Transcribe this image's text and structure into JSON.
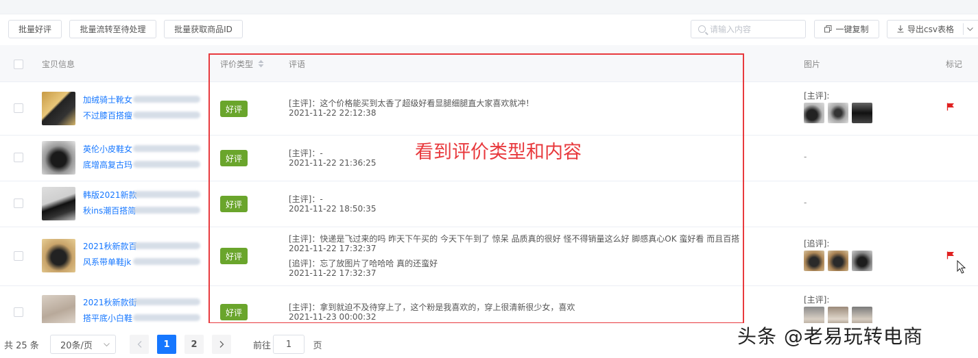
{
  "toolbar": {
    "batch_good": "批量好评",
    "batch_transfer": "批量流转至待处理",
    "batch_get_id": "批量获取商品ID",
    "search_placeholder": "请输入内容",
    "copy_all": "一键复制",
    "export_csv": "导出csv表格"
  },
  "table": {
    "headers": {
      "product": "宝贝信息",
      "rating_type": "评价类型",
      "comment": "评语",
      "images": "图片",
      "mark": "标记"
    },
    "rows": [
      {
        "title1": "加绒骑士靴女",
        "title2": "不过膝百搭瘦",
        "tag": "好评",
        "lines": [
          "[主评]：这个价格能买到太香了超级好看显腿细腿直大家喜欢就冲！",
          "2021-11-22 22:12:38"
        ],
        "pic_label": "[主评]:",
        "flag": true
      },
      {
        "title1": "英伦小皮鞋女",
        "title2": "底增高复古玛",
        "tag": "好评",
        "lines": [
          "[主评]：-",
          "2021-11-22 21:36:25"
        ],
        "pic_label": "-",
        "flag": false
      },
      {
        "title1": "韩版2021新款",
        "title2": "秋ins潮百搭简",
        "tag": "好评",
        "lines": [
          "[主评]：-",
          "2021-11-22 18:50:35"
        ],
        "pic_label": "-",
        "flag": false
      },
      {
        "title1": "2021秋新款百",
        "title2": "风系带单鞋jk",
        "tag": "好评",
        "lines": [
          "[主评]：快递是飞过来的吗 昨天下午买的 今天下午到了 惊呆 品质真的很好 怪不得销量这么好 脚感真心OK 蛮好看 而且百搭",
          "2021-11-22 17:32:37",
          "[追评]：忘了放图片了哈哈哈 真的还蛮好",
          "2021-11-22 17:32:37"
        ],
        "pic_label": "[追评]:",
        "flag": true
      },
      {
        "title1": "2021秋新款街",
        "title2": "搭平底小白鞋",
        "tag": "好评",
        "lines": [
          "[主评]：拿到就迫不及待穿上了，这个粉是我喜欢的，穿上很清新很少女，喜欢",
          "2021-11-23 00:00:32"
        ],
        "pic_label": "[主评]:",
        "flag": false
      }
    ]
  },
  "annotation": "看到评价类型和内容",
  "pagination": {
    "total": "共 25 条",
    "page_size": "20条/页",
    "page1": "1",
    "page2": "2",
    "goto_label": "前往",
    "goto_value": "1",
    "goto_suffix": "页"
  },
  "watermark": "头条 @老易玩转电商",
  "colors": {
    "tag_green": "#6aa52c",
    "annotation_red": "#e8393d",
    "link_blue": "#1677ff",
    "flag_red": "#e02020"
  }
}
